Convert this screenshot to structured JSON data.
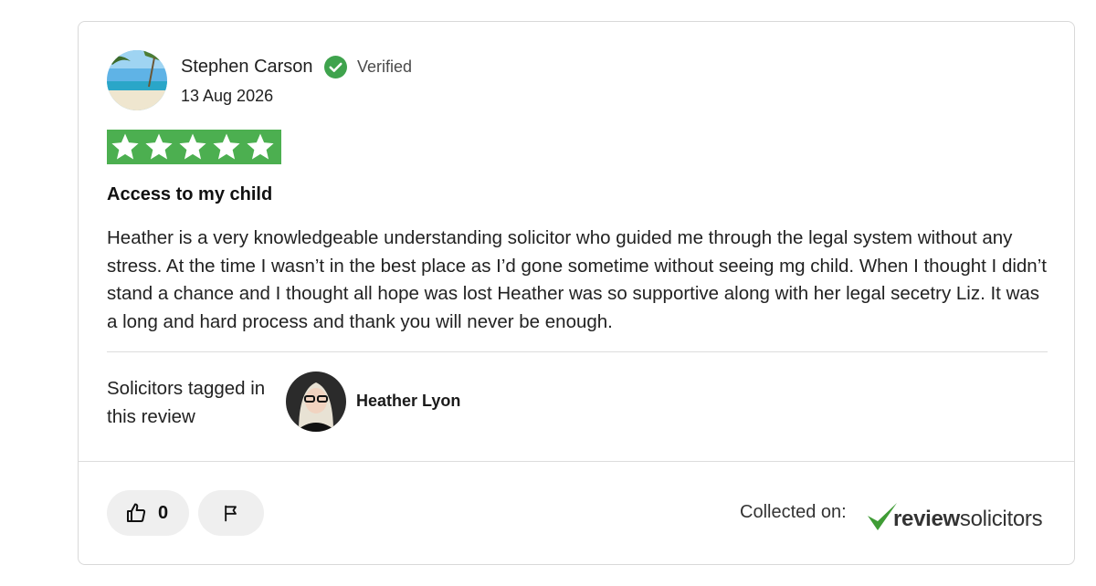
{
  "review": {
    "author_name": "Stephen Carson",
    "verified_label": "Verified",
    "date": "13 Aug 2026",
    "rating": 5,
    "title": "Access to my child",
    "body": "Heather is a very knowledgeable understanding solicitor who guided me through the legal system without any stress. At the time I wasn’t in the best place as I’d gone sometime without seeing mg child. When I thought I didn’t stand a chance and I thought all hope was lost Heather was so supportive along with her legal secetry Liz. It was a long and hard process and thank you will never be enough."
  },
  "tagged": {
    "label": "Solicitors tagged in this review",
    "solicitor_name": "Heather Lyon"
  },
  "actions": {
    "like_count": "0"
  },
  "footer": {
    "collected_label": "Collected on:",
    "brand_bold": "review",
    "brand_light": "solicitors"
  },
  "icons": {
    "verified": "check-circle-icon",
    "star": "star-icon",
    "like": "thumbs-up-icon",
    "flag": "flag-icon"
  },
  "colors": {
    "star_background": "#4caf50",
    "verified_green": "#3fa34d",
    "button_background": "#efefef",
    "brand_green": "#3f9c35"
  }
}
